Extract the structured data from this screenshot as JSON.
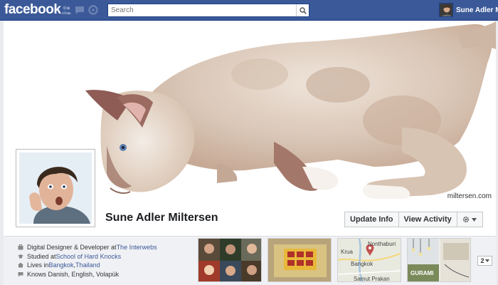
{
  "topbar": {
    "logo": "facebook",
    "search_placeholder": "Search",
    "user_name": "Sune Adler M",
    "icons": [
      "friend-requests-icon",
      "messages-icon",
      "notifications-icon",
      "search-icon"
    ]
  },
  "cover": {
    "credit": "miltersen.com"
  },
  "profile": {
    "name": "Sune Adler Miltersen"
  },
  "actions": {
    "update_info": "Update Info",
    "view_activity": "View Activity",
    "gear_icon": "gear-icon"
  },
  "about": {
    "work_prefix": "Digital Designer & Developer at ",
    "work_link": "The Interwebs",
    "study_prefix": "Studied at ",
    "study_link": "School of Hard Knocks",
    "lives_prefix": "Lives in ",
    "lives_city": "Bangkok",
    "lives_sep": ", ",
    "lives_country": "Thailand",
    "languages": "Knows Danish, English, Volapük"
  },
  "tiles": {
    "map_label_1": "Nonthaburi",
    "map_label_2": "Bangkok",
    "map_label_3": "Samut Prakan",
    "map_label_4": "Krua",
    "likes_label": "GURAMI",
    "more_count": "2"
  },
  "colors": {
    "brand": "#3b5998",
    "link": "#3b5998"
  }
}
